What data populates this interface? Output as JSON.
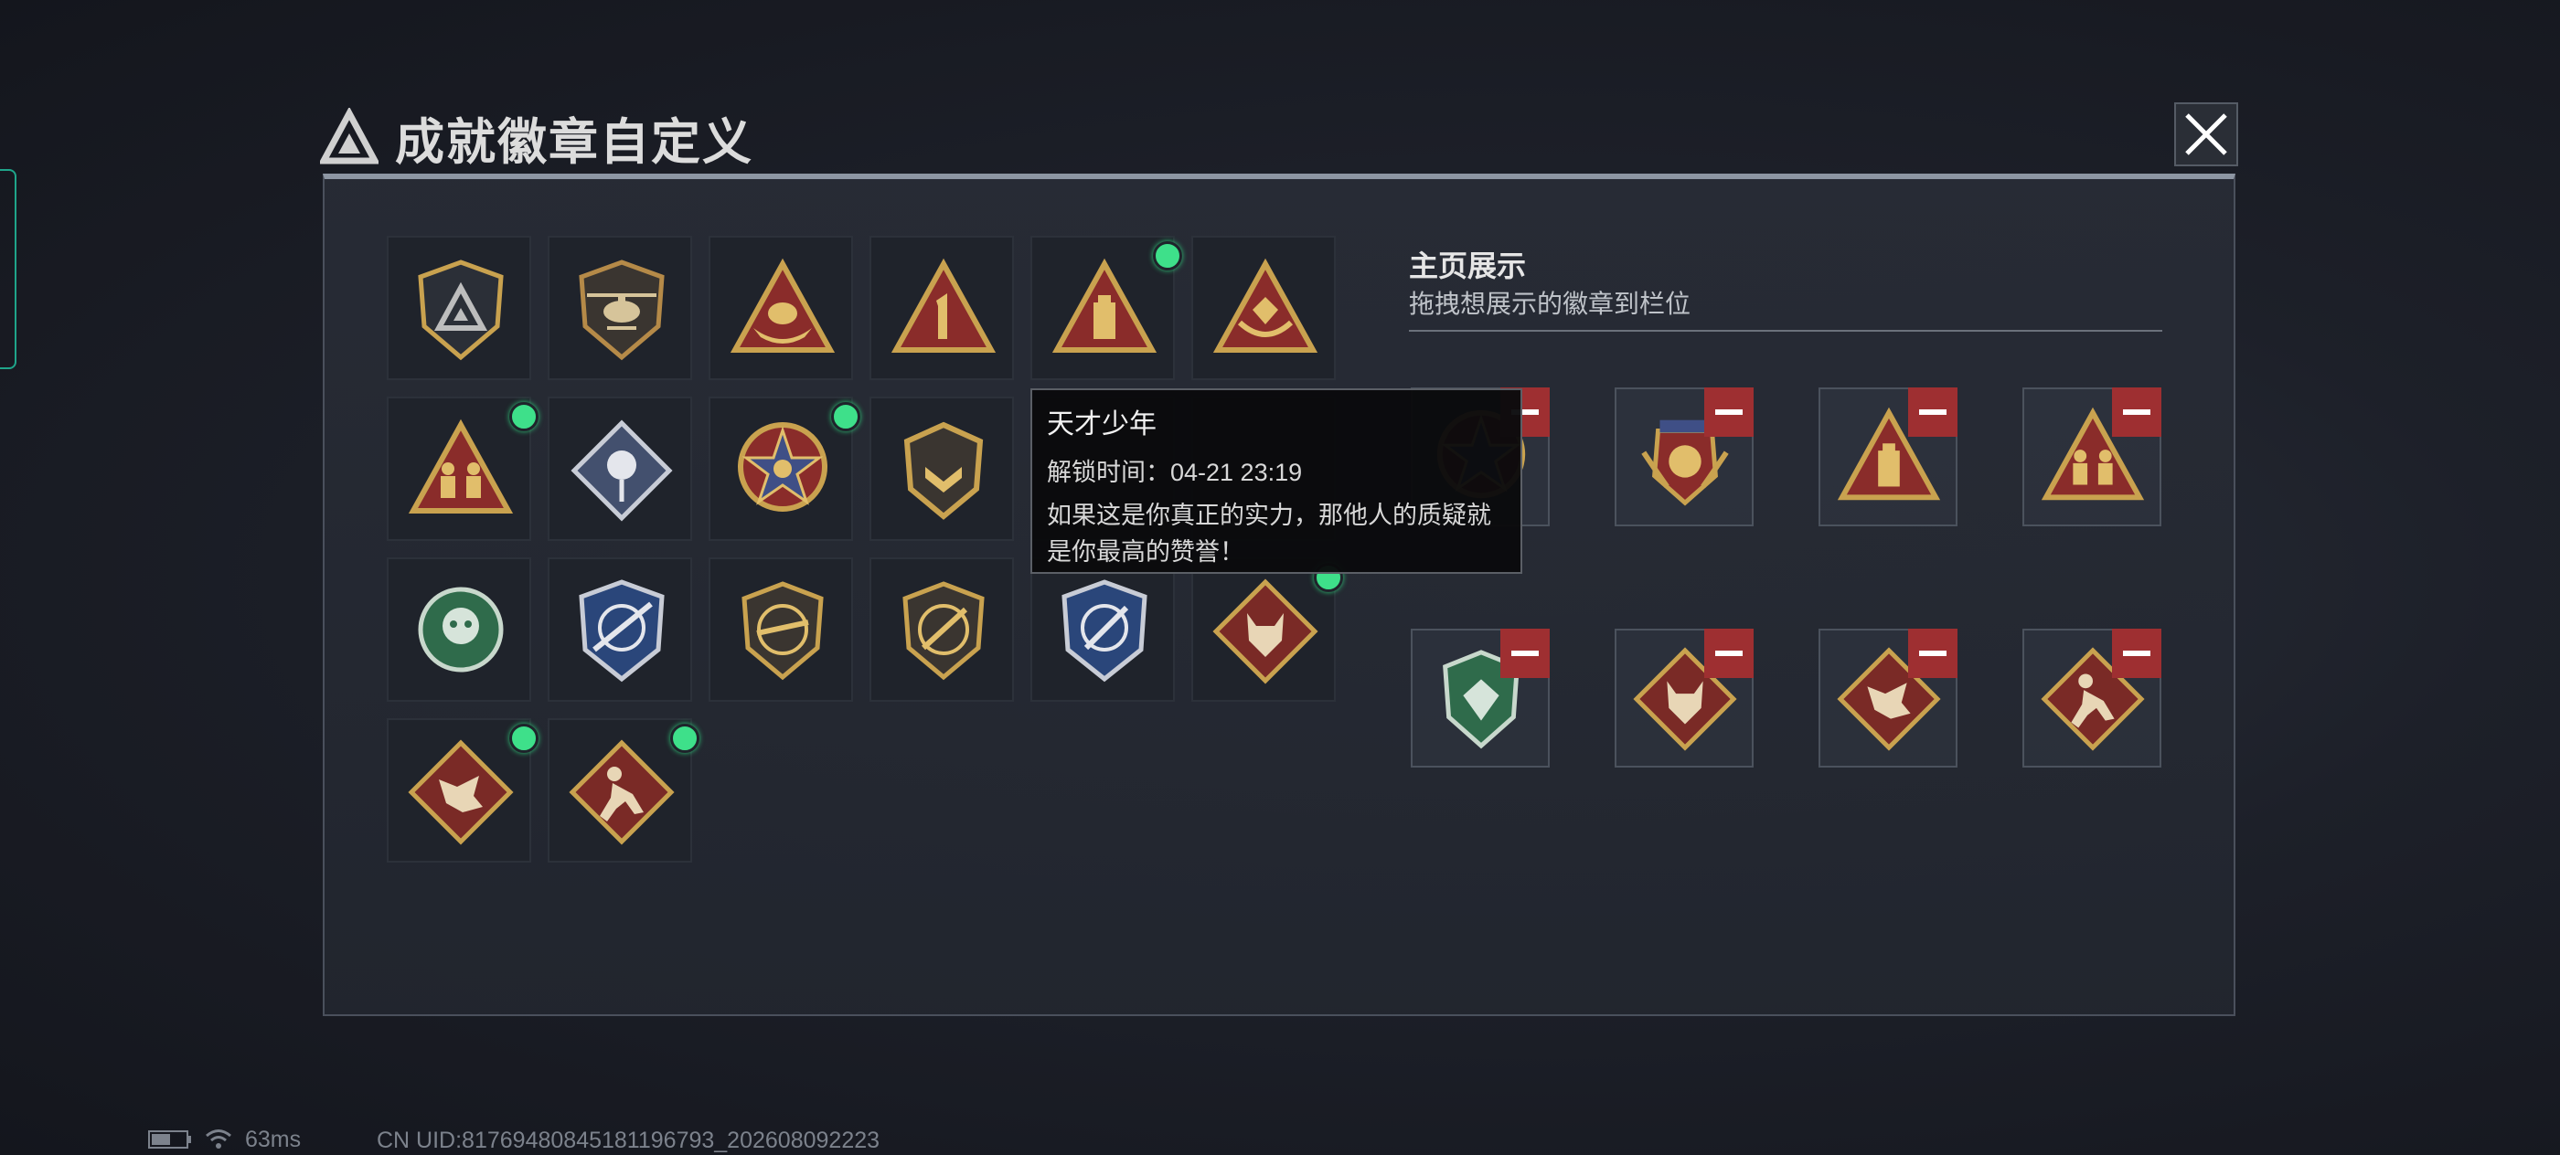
{
  "header": {
    "title": "成就徽章自定义"
  },
  "badges": [
    {
      "icon": "shield-triangle-logo-badge",
      "new": false
    },
    {
      "icon": "helicopter-shield-badge",
      "new": false
    },
    {
      "icon": "gold-ingot-triangle-badge",
      "new": false
    },
    {
      "icon": "number-one-triangle-badge",
      "new": false
    },
    {
      "icon": "flashdrive-triangle-badge",
      "new": true
    },
    {
      "icon": "hands-gem-triangle-badge",
      "new": false
    },
    {
      "icon": "squad-triangle-badge",
      "new": true
    },
    {
      "icon": "rose-diamond-badge",
      "new": false
    },
    {
      "icon": "star-medal-badge",
      "new": true
    },
    {
      "icon": "chevron-shield-badge",
      "new": false
    },
    {
      "icon": "hidden-badge",
      "new": true
    },
    {
      "icon": "hidden-badge",
      "new": false
    },
    {
      "icon": "green-emblem-badge",
      "new": false
    },
    {
      "icon": "sniper-crosshair-shield-badge",
      "new": false
    },
    {
      "icon": "rifle-circle-shield-badge",
      "new": false
    },
    {
      "icon": "knife-circle-shield-badge",
      "new": false
    },
    {
      "icon": "knife-crosshair-shield-badge",
      "new": false
    },
    {
      "icon": "wolf-diamond-badge",
      "new": true
    },
    {
      "icon": "dragon-diamond-badge",
      "new": true
    },
    {
      "icon": "runner-diamond-badge",
      "new": true
    }
  ],
  "showcase": {
    "title": "主页展示",
    "subtitle": "拖拽想展示的徽章到栏位",
    "slots": [
      {
        "icon": "star-medal-badge",
        "removable": true
      },
      {
        "icon": "winged-medal-badge",
        "removable": true
      },
      {
        "icon": "flashdrive-triangle-badge",
        "removable": true
      },
      {
        "icon": "squad-triangle-badge",
        "removable": true
      },
      {
        "icon": "green-gem-shield-badge",
        "removable": true
      },
      {
        "icon": "wolf-diamond-badge",
        "removable": true
      },
      {
        "icon": "dragon-diamond-badge",
        "removable": true
      },
      {
        "icon": "runner-diamond-badge",
        "removable": true
      }
    ]
  },
  "tooltip": {
    "name": "天才少年",
    "unlock": "解锁时间：04-21 23:19",
    "desc_line1": "如果这是你真正的实力，那他人的质疑就",
    "desc_line2": "是你最高的赞誉！"
  },
  "status": {
    "ping": "63ms",
    "uid": "CN UID:817694808451811967​93_202608092223"
  },
  "colors": {
    "accent_new": "#3ee08a",
    "remove": "#9e2f31",
    "gold": "#c9a24f",
    "crimson": "#8a2c2a",
    "teal": "#1fa58a"
  }
}
